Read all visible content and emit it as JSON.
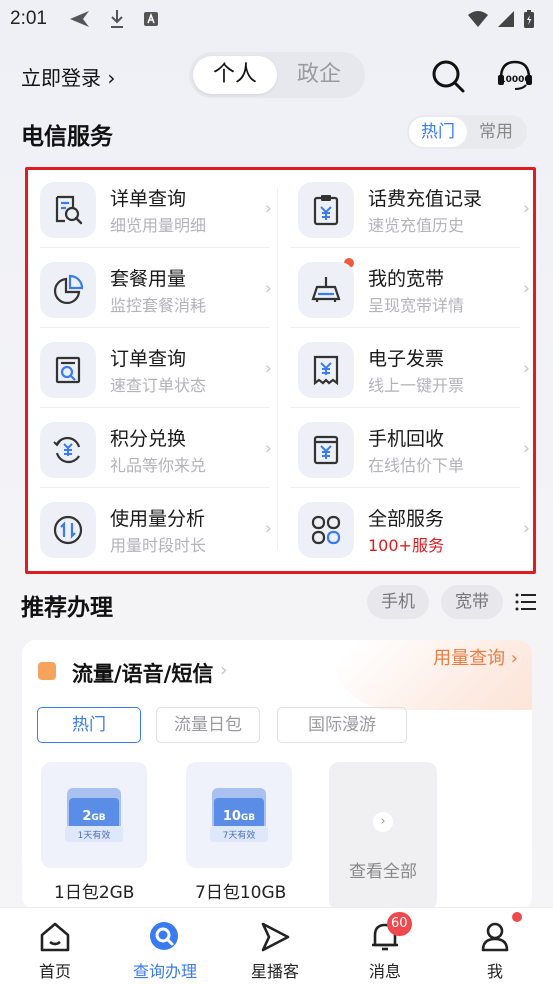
{
  "status_bar": {
    "time": "2:01"
  },
  "header": {
    "login_label": "立即登录 ›",
    "segment": [
      "个人",
      "政企"
    ],
    "search_icon": "search-icon",
    "service_icon": "10000-icon"
  },
  "telecom_section": {
    "title": "电信服务",
    "filters": [
      "热门",
      "常用"
    ]
  },
  "services": [
    {
      "title": "详单查询",
      "sub": "细览用量明细",
      "icon": "bill-search-icon"
    },
    {
      "title": "话费充值记录",
      "sub": "速览充值历史",
      "icon": "recharge-record-icon"
    },
    {
      "title": "套餐用量",
      "sub": "监控套餐消耗",
      "icon": "pie-usage-icon"
    },
    {
      "title": "我的宽带",
      "sub": "呈现宽带详情",
      "icon": "router-icon"
    },
    {
      "title": "订单查询",
      "sub": "速查订单状态",
      "icon": "order-search-icon"
    },
    {
      "title": "电子发票",
      "sub": "线上一键开票",
      "icon": "invoice-icon"
    },
    {
      "title": "积分兑换",
      "sub": "礼品等你来兑",
      "icon": "points-exchange-icon"
    },
    {
      "title": "手机回收",
      "sub": "在线估价下单",
      "icon": "phone-recycle-icon"
    },
    {
      "title": "使用量分析",
      "sub": "用量时段时长",
      "icon": "usage-analysis-icon"
    },
    {
      "title": "全部服务",
      "sub": "100+服务",
      "icon": "all-services-icon"
    }
  ],
  "recommend": {
    "title": "推荐办理",
    "chips": [
      "手机",
      "宽带"
    ],
    "menu_icon": "list-icon"
  },
  "card": {
    "title": "流量/语音/短信",
    "link": "用量查询 ›",
    "tabs": [
      "热门",
      "流量日包",
      "国际漫游"
    ],
    "packages": [
      {
        "size": "2",
        "unit": "GB",
        "validity": "1天有效",
        "label": "1日包2GB"
      },
      {
        "size": "10",
        "unit": "GB",
        "validity": "7天有效",
        "label": "7日包10GB"
      }
    ],
    "view_all": "查看全部"
  },
  "nav": {
    "items": [
      {
        "label": "首页",
        "icon": "home-icon"
      },
      {
        "label": "查询办理",
        "icon": "query-icon"
      },
      {
        "label": "星播客",
        "icon": "play-icon"
      },
      {
        "label": "消息",
        "icon": "bell-icon"
      },
      {
        "label": "我",
        "icon": "person-icon"
      }
    ],
    "message_badge": "60"
  },
  "colors": {
    "accent": "#3a7bf0",
    "highlight_border": "#e01b22",
    "orange": "#ea7d43"
  }
}
